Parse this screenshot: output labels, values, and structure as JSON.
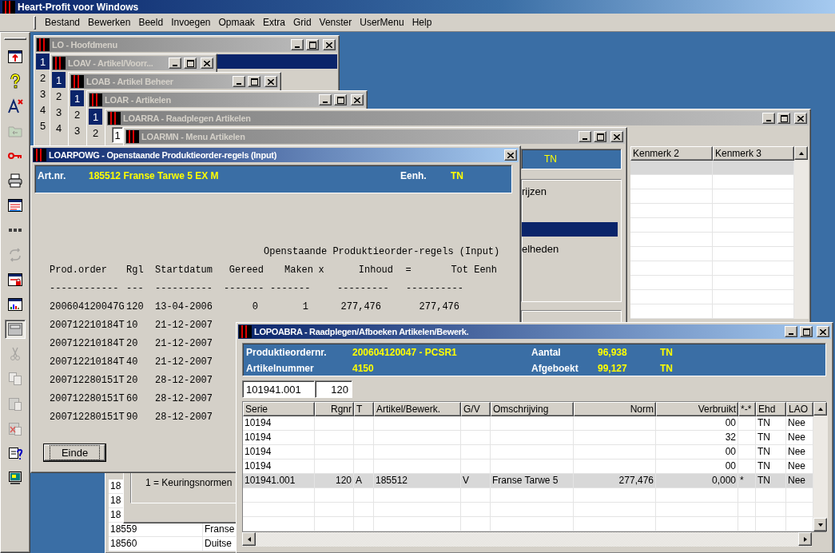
{
  "app": {
    "title": "Heart-Profit voor Windows"
  },
  "menu": [
    "Bestand",
    "Bewerken",
    "Beeld",
    "Invoegen",
    "Opmaak",
    "Extra",
    "Grid",
    "Venster",
    "UserMenu",
    "Help"
  ],
  "toolbar": [
    {
      "kind": "exit",
      "disabled": false,
      "selected": false
    },
    {
      "kind": "help",
      "disabled": false,
      "selected": false
    },
    {
      "kind": "font",
      "disabled": false,
      "selected": false
    },
    {
      "kind": "folder",
      "disabled": true,
      "selected": false
    },
    {
      "kind": "key",
      "disabled": false,
      "selected": false
    },
    {
      "kind": "print",
      "disabled": false,
      "selected": false
    },
    {
      "kind": "window-list",
      "disabled": false,
      "selected": false
    },
    {
      "kind": "dots",
      "disabled": false,
      "selected": false
    },
    {
      "kind": "refresh",
      "disabled": true,
      "selected": false
    },
    {
      "kind": "window-lock",
      "disabled": false,
      "selected": false
    },
    {
      "kind": "window-chart",
      "disabled": false,
      "selected": false
    },
    {
      "kind": "window",
      "disabled": false,
      "selected": true
    },
    {
      "kind": "cut",
      "disabled": true,
      "selected": false
    },
    {
      "kind": "copy",
      "disabled": true,
      "selected": false
    },
    {
      "kind": "paste",
      "disabled": true,
      "selected": false
    },
    {
      "kind": "paste-delete",
      "disabled": true,
      "selected": false
    },
    {
      "kind": "clipboard-help",
      "disabled": false,
      "selected": false
    },
    {
      "kind": "monitor",
      "disabled": false,
      "selected": false
    }
  ],
  "windows": [
    {
      "kind": "menu",
      "title": "LO - Hoofdmenu",
      "active": false,
      "controls": [
        {
          "kind": "minimize"
        },
        {
          "kind": "maximize"
        },
        {
          "kind": "close"
        }
      ],
      "numbers": [
        {
          "label": "1",
          "selected": true
        },
        {
          "label": "2",
          "selected": false
        },
        {
          "label": "3",
          "selected": false
        },
        {
          "label": "4",
          "selected": false
        },
        {
          "label": "5",
          "selected": false
        }
      ]
    },
    {
      "kind": "menu",
      "title": "LOAV - Artikel/Voorr...",
      "active": false,
      "controls": [
        {
          "kind": "minimize"
        },
        {
          "kind": "maximize"
        },
        {
          "kind": "close"
        }
      ],
      "numbers": [
        {
          "label": "1",
          "selected": true
        },
        {
          "label": "2",
          "selected": false
        },
        {
          "label": "3",
          "selected": false
        },
        {
          "label": "4",
          "selected": false
        }
      ]
    },
    {
      "kind": "menu",
      "title": "LOAB - Artikel Beheer",
      "active": false,
      "controls": [
        {
          "kind": "minimize"
        },
        {
          "kind": "maximize"
        },
        {
          "kind": "close"
        }
      ],
      "numbers": [
        {
          "label": "1",
          "selected": true
        },
        {
          "label": "2",
          "selected": false
        },
        {
          "label": "3",
          "selected": false
        }
      ]
    },
    {
      "kind": "menu",
      "title": "LOAR - Artikelen",
      "active": false,
      "controls": [
        {
          "kind": "minimize"
        },
        {
          "kind": "maximize"
        },
        {
          "kind": "close"
        }
      ],
      "numbers": [
        {
          "label": "1",
          "selected": true
        },
        {
          "label": "2",
          "selected": false
        }
      ]
    },
    {
      "kind": "lookup",
      "title": "LOARRA - Raadplegen Artikelen",
      "active": false,
      "controls": [
        {
          "kind": "minimize"
        },
        {
          "kind": "maximize"
        },
        {
          "kind": "close"
        }
      ],
      "number_field": "1",
      "grid": {
        "columns": [
          "Kenmerk 2",
          "Kenmerk 3"
        ],
        "rows": [
          {
            "selected": true
          },
          {
            "selected": false
          },
          {
            "selected": false
          },
          {
            "selected": false
          },
          {
            "selected": false
          },
          {
            "selected": false
          },
          {
            "selected": false
          },
          {
            "selected": false
          },
          {
            "selected": false
          },
          {
            "selected": false
          },
          {
            "selected": false
          }
        ]
      },
      "list": [
        {
          "code": "18"
        },
        {
          "code": "18"
        },
        {
          "code": "18"
        },
        {
          "code": "18559",
          "name": "Franse"
        },
        {
          "code": "18560",
          "name": "Duitse"
        }
      ]
    },
    {
      "kind": "menu_panel",
      "title": "LOARMN - Menu Artikelen",
      "active": false,
      "controls": [
        {
          "kind": "minimize"
        },
        {
          "kind": "maximize"
        },
        {
          "kind": "close"
        }
      ],
      "unit": "TN",
      "options": [
        {
          "label": "rijzen",
          "selected": false
        },
        {
          "selected": true
        },
        {
          "label": "elheden",
          "selected": false
        }
      ],
      "legend": "1 = Keuringsnormen"
    },
    {
      "kind": "report",
      "title": "LOARPOWG - Openstaande Produktieorder-regels (Input)",
      "active": true,
      "controls": [
        {
          "kind": "close"
        }
      ],
      "header": {
        "label": "Art.nr.",
        "value": "185512  Franse Tarwe 5 EX M",
        "unit_label": "Eenh.",
        "unit": "TN"
      },
      "report": [
        {
          "kind": "title",
          "cells": [
            "Openstaande Produktieorder-regels (Input)"
          ]
        },
        {
          "kind": "header",
          "cells": [
            "Prod.order",
            "Rgl",
            "Startdatum",
            "Gereed",
            "Maken",
            "x",
            "Inhoud",
            "=",
            "Tot Eenh"
          ]
        },
        {
          "kind": "rule",
          "cells": [
            "------------",
            "---",
            "----------",
            "-------",
            "-------",
            "---------",
            "----------"
          ]
        },
        {
          "kind": "data",
          "cells": [
            "200604120047G",
            "120",
            "13-04-2006",
            "0",
            "1",
            "277,476",
            "277,476"
          ]
        },
        {
          "kind": "data",
          "cells": [
            "200712210184T",
            "10",
            "21-12-2007"
          ]
        },
        {
          "kind": "data",
          "cells": [
            "200712210184T",
            "20",
            "21-12-2007"
          ]
        },
        {
          "kind": "data",
          "cells": [
            "200712210184T",
            "40",
            "21-12-2007"
          ]
        },
        {
          "kind": "data",
          "cells": [
            "200712280151T",
            "20",
            "28-12-2007"
          ]
        },
        {
          "kind": "data",
          "cells": [
            "200712280151T",
            "60",
            "28-12-2007"
          ]
        },
        {
          "kind": "data",
          "cells": [
            "200712280151T",
            "90",
            "28-12-2007"
          ]
        }
      ],
      "button": "Einde"
    },
    {
      "kind": "booking",
      "title": "LOPOABRA - Raadplegen/Afboeken Artikelen/Bewerk.",
      "active": true,
      "controls": [
        {
          "kind": "minimize"
        },
        {
          "kind": "maximize"
        },
        {
          "kind": "close"
        }
      ],
      "header": [
        {
          "label": "Produktieordernr.",
          "value": "200604120047 - PCSR1",
          "label2": "Aantal",
          "value2": "96,938",
          "unit": "TN"
        },
        {
          "label": "Artikelnummer",
          "value": "4150",
          "label2": "Afgeboekt",
          "value2": "99,127",
          "unit": "TN"
        }
      ],
      "filters": [
        {
          "value": "101941.001"
        },
        {
          "value": "120"
        }
      ],
      "grid": {
        "columns": [
          "Serie",
          "Rgnr",
          "T",
          "Artikel/Bewerk.",
          "G/V",
          "Omschrijving",
          "Norm",
          "Verbruikt",
          "*-*",
          "Ehd",
          "LAO"
        ],
        "rows": [
          {
            "selected": false,
            "cells": {
              "serie": "10194",
              "verbruikt": "00",
              "ehd": "TN",
              "lao": "Nee"
            }
          },
          {
            "selected": false,
            "cells": {
              "serie": "10194",
              "verbruikt": "32",
              "ehd": "TN",
              "lao": "Nee"
            }
          },
          {
            "selected": false,
            "cells": {
              "serie": "10194",
              "verbruikt": "00",
              "ehd": "TN",
              "lao": "Nee"
            }
          },
          {
            "selected": false,
            "cells": {
              "serie": "10194",
              "verbruikt": "00",
              "ehd": "TN",
              "lao": "Nee"
            }
          },
          {
            "selected": true,
            "cells": {
              "serie": "101941.001",
              "rgnr": "120",
              "t": "A",
              "artikel": "185512",
              "gv": "V",
              "omschrijving": "Franse Tarwe 5",
              "norm": "277,476",
              "verbruikt": "0,000",
              "mark": "*",
              "ehd": "TN",
              "lao": "Nee"
            }
          },
          {
            "selected": false
          },
          {
            "selected": false
          },
          {
            "selected": false
          }
        ]
      }
    }
  ]
}
